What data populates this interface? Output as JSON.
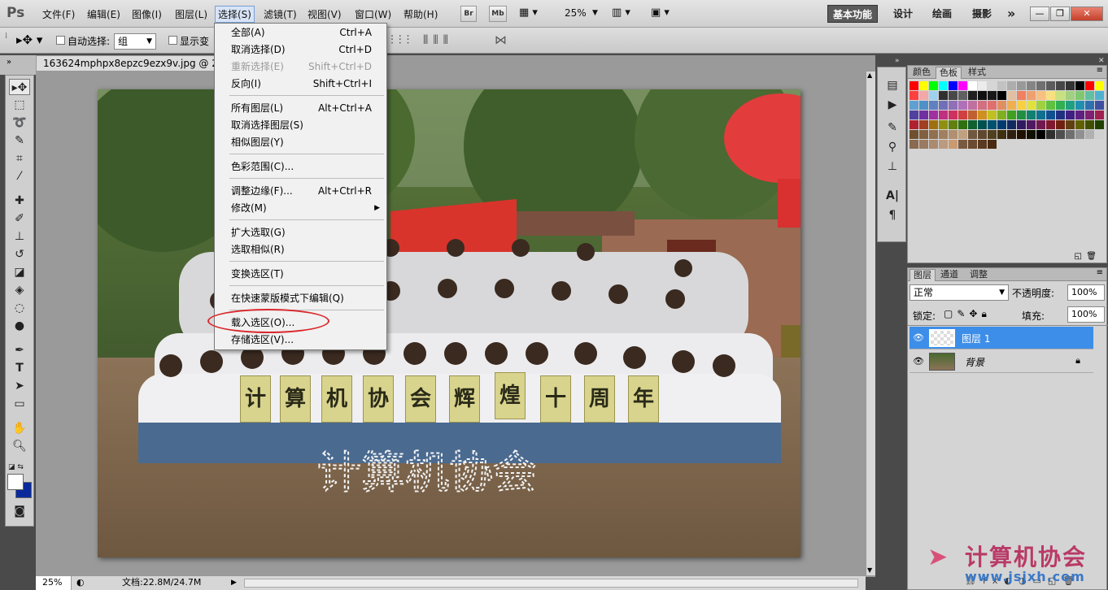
{
  "app": {
    "logo": "Ps"
  },
  "menubar": {
    "items": [
      "文件(F)",
      "编辑(E)",
      "图像(I)",
      "图层(L)",
      "选择(S)",
      "滤镜(T)",
      "视图(V)",
      "窗口(W)",
      "帮助(H)"
    ],
    "bridge_btn": "Br",
    "minibridge_btn": "Mb",
    "zoom": "25%",
    "workspaces": [
      "基本功能",
      "设计",
      "绘画",
      "摄影"
    ],
    "more": "»"
  },
  "options": {
    "auto_select_label": "自动选择:",
    "auto_select_value": "组",
    "show_transform_label": "显示变"
  },
  "document": {
    "tab_title": "163624mphpx8epzc9ezx9v.jpg @ 25%",
    "canvas_text": "计算机协会"
  },
  "signs": [
    "计",
    "算",
    "机",
    "协",
    "会",
    "辉",
    "煌",
    "十",
    "周",
    "年"
  ],
  "select_menu": {
    "items": [
      {
        "label": "全部(A)",
        "shortcut": "Ctrl+A",
        "disabled": false
      },
      {
        "label": "取消选择(D)",
        "shortcut": "Ctrl+D",
        "disabled": false
      },
      {
        "label": "重新选择(E)",
        "shortcut": "Shift+Ctrl+D",
        "disabled": true
      },
      {
        "label": "反向(I)",
        "shortcut": "Shift+Ctrl+I",
        "disabled": false
      },
      {
        "label": "所有图层(L)",
        "shortcut": "Alt+Ctrl+A",
        "disabled": false
      },
      {
        "label": "取消选择图层(S)",
        "shortcut": "",
        "disabled": false
      },
      {
        "label": "相似图层(Y)",
        "shortcut": "",
        "disabled": false
      },
      {
        "label": "色彩范围(C)...",
        "shortcut": "",
        "disabled": false
      },
      {
        "label": "调整边缘(F)...",
        "shortcut": "Alt+Ctrl+R",
        "disabled": false
      },
      {
        "label": "修改(M)",
        "shortcut": "",
        "disabled": false,
        "submenu": true
      },
      {
        "label": "扩大选取(G)",
        "shortcut": "",
        "disabled": false
      },
      {
        "label": "选取相似(R)",
        "shortcut": "",
        "disabled": false
      },
      {
        "label": "变换选区(T)",
        "shortcut": "",
        "disabled": false
      },
      {
        "label": "在快速蒙版模式下编辑(Q)",
        "shortcut": "",
        "disabled": false
      },
      {
        "label": "载入选区(O)...",
        "shortcut": "",
        "disabled": false
      },
      {
        "label": "存储选区(V)...",
        "shortcut": "",
        "disabled": false
      }
    ]
  },
  "swatches_panel": {
    "tabs": [
      "颜色",
      "色板",
      "样式"
    ]
  },
  "layers_panel": {
    "tabs": [
      "图层",
      "通道",
      "调整"
    ],
    "blend_mode": "正常",
    "opacity_label": "不透明度:",
    "opacity_value": "100%",
    "lock_label": "锁定:",
    "fill_label": "填充:",
    "fill_value": "100%",
    "layers": [
      {
        "name": "图层 1",
        "selected": true
      },
      {
        "name": "背景",
        "selected": false
      }
    ]
  },
  "status": {
    "zoom": "25%",
    "doc_info": "文档:22.8M/24.7M"
  },
  "watermark": {
    "text": "计算机协会",
    "url": "www.jsjxh.com"
  },
  "colors": {
    "accent": "#3d8ee8",
    "highlight_ring": "#d9282c"
  }
}
